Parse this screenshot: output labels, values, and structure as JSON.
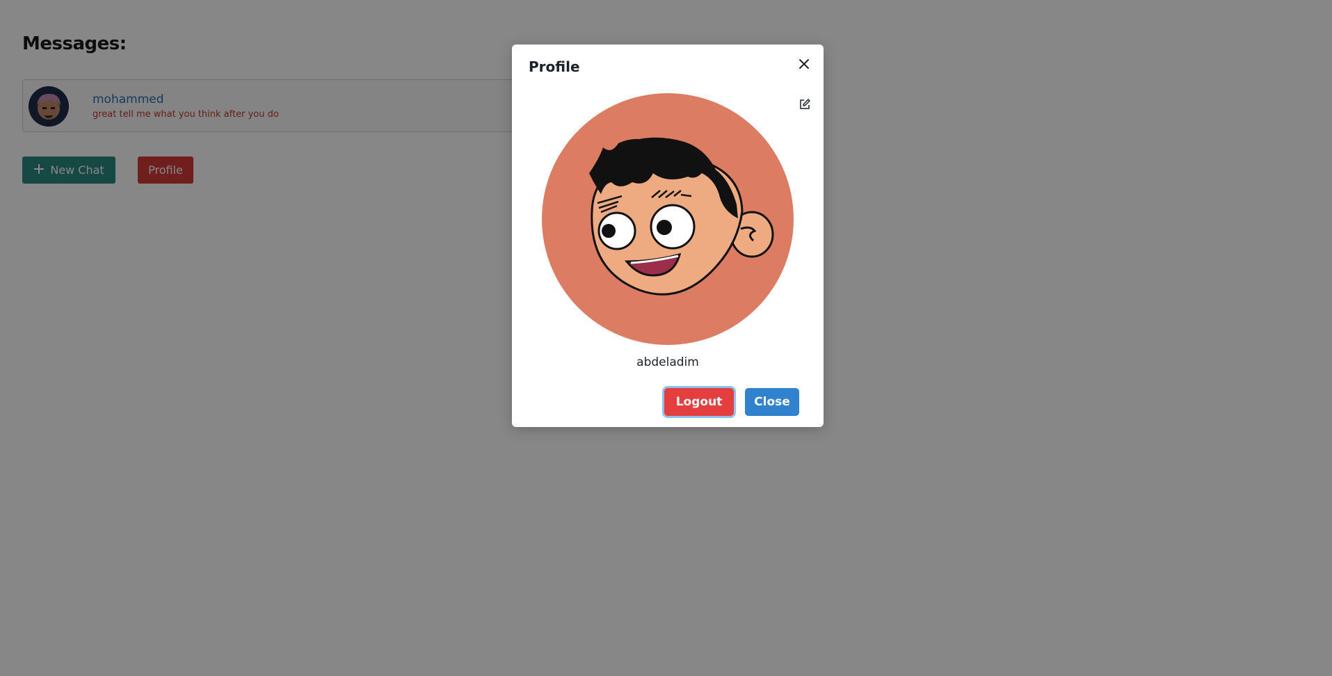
{
  "messages": {
    "title": "Messages:",
    "conversations": [
      {
        "name": "mohammed",
        "last_message": "great tell me what you think after you do",
        "avatar_icon": "anime-avatar-icon"
      }
    ]
  },
  "actions": {
    "new_chat_label": "New Chat",
    "new_chat_icon": "plus-icon",
    "profile_label": "Profile"
  },
  "modal": {
    "title": "Profile",
    "close_icon": "close-icon",
    "edit_icon": "edit-icon",
    "avatar_icon": "cartoon-boy-avatar",
    "username": "abdeladim",
    "logout_label": "Logout",
    "close_label": "Close"
  },
  "colors": {
    "overlay": "#000000",
    "new_chat_bg": "#2a8a80",
    "profile_bg": "#d33a3a",
    "logout_bg": "#e53e3e",
    "close_bg": "#3182ce",
    "avatar_bg": "#dc7c62",
    "conv_name": "#2c6cb0",
    "conv_last": "#c0392b"
  }
}
